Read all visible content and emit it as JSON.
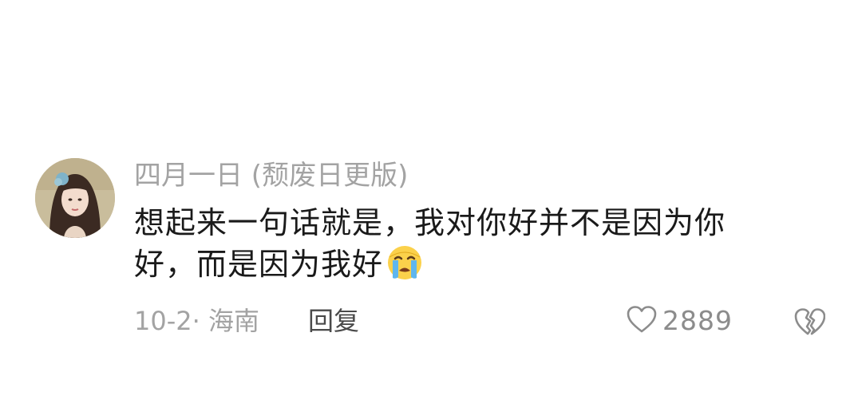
{
  "comment": {
    "username": "四月一日 (颓废日更版)",
    "content": "想起来一句话就是，我对你好并不是因为你好，而是因为我好",
    "emoji": "loudly-crying-face",
    "meta": "10-2· 海南",
    "reply_label": "回复",
    "like_count": "2889",
    "like_icon": "heart-outline-icon",
    "dislike_icon": "broken-heart-icon"
  },
  "colors": {
    "username": "#a3a3a3",
    "content": "#1a1a1a",
    "meta": "#a3a3a3",
    "reply": "#4a4a4a",
    "icon": "#8c8c8c"
  }
}
